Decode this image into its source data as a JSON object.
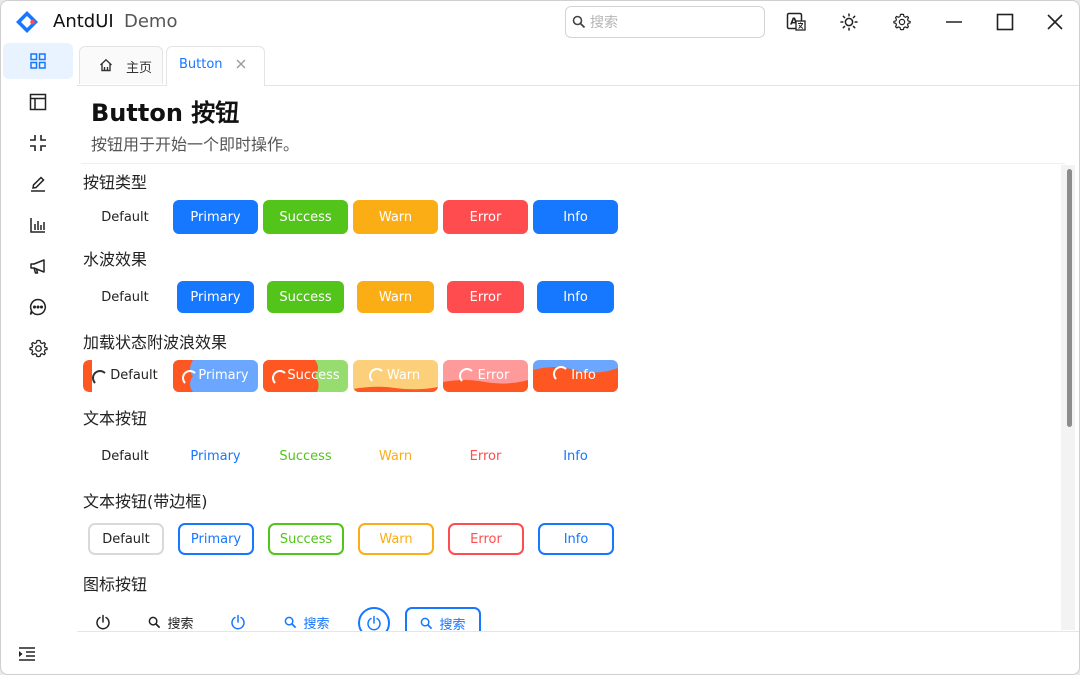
{
  "app": {
    "name": "AntdUI",
    "subtitle": "Demo"
  },
  "search": {
    "placeholder": "搜索"
  },
  "tabs": {
    "home": "主页",
    "button": "Button"
  },
  "page": {
    "title": "Button 按钮",
    "description": "按钮用于开始一个即时操作。"
  },
  "sections": {
    "types": "按钮类型",
    "ripple": "水波效果",
    "loading": "加载状态附波浪效果",
    "text": "文本按钮",
    "text_border": "文本按钮(带边框)",
    "icon": "图标按钮"
  },
  "buttons": {
    "default": "Default",
    "primary": "Primary",
    "success": "Success",
    "warn": "Warn",
    "error": "Error",
    "info": "Info"
  },
  "icon_buttons": {
    "search_label": "搜索"
  },
  "colors": {
    "primary": "#1677ff",
    "success": "#52c41a",
    "warn": "#faad14",
    "error": "#ff4d4f",
    "wave": "#ff5722"
  },
  "icons": {
    "logo": "antd-logo",
    "translate": "translate-icon",
    "theme": "sun-icon",
    "settings": "gear-icon",
    "sidebar": [
      "grid-icon",
      "layout-icon",
      "compress-icon",
      "edit-icon",
      "bar-chart-icon",
      "megaphone-icon",
      "chat-icon",
      "gear-icon"
    ]
  }
}
